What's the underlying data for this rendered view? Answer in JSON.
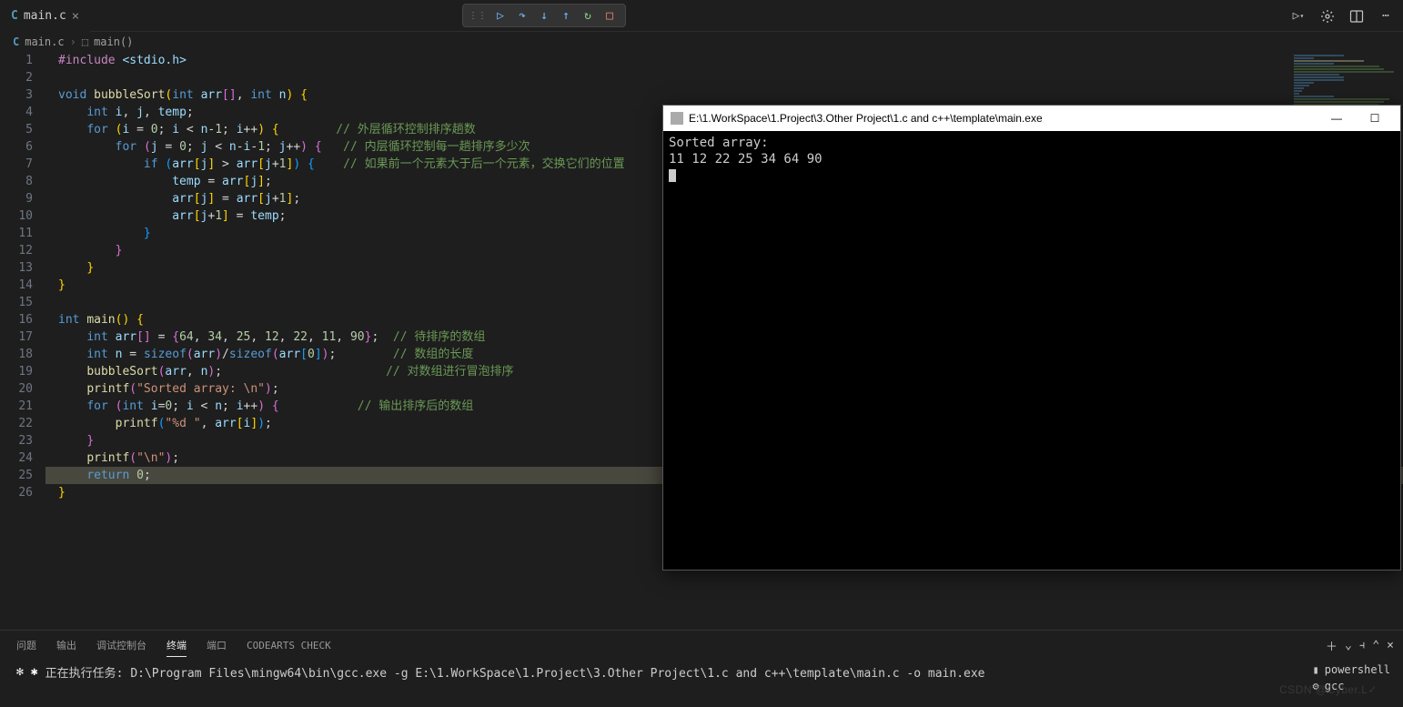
{
  "tab": {
    "icon": "C",
    "name": "main.c"
  },
  "breadcrumb": {
    "file": "main.c",
    "symbol": "main()"
  },
  "lines": [
    {
      "n": 1,
      "seg": [
        [
          "mac",
          "#include "
        ],
        [
          "inc",
          "<stdio.h>"
        ]
      ]
    },
    {
      "n": 2,
      "seg": []
    },
    {
      "n": 3,
      "seg": [
        [
          "kw",
          "void"
        ],
        [
          "op",
          " "
        ],
        [
          "fn",
          "bubbleSort"
        ],
        [
          "pn",
          "("
        ],
        [
          "kw",
          "int"
        ],
        [
          "op",
          " "
        ],
        [
          "var",
          "arr"
        ],
        [
          "pn2",
          "[]"
        ],
        [
          "op",
          ", "
        ],
        [
          "kw",
          "int"
        ],
        [
          "op",
          " "
        ],
        [
          "var",
          "n"
        ],
        [
          "pn",
          ")"
        ],
        [
          "op",
          " "
        ],
        [
          "pn",
          "{"
        ]
      ]
    },
    {
      "n": 4,
      "indent": 1,
      "seg": [
        [
          "kw",
          "int"
        ],
        [
          "op",
          " "
        ],
        [
          "var",
          "i"
        ],
        [
          "op",
          ", "
        ],
        [
          "var",
          "j"
        ],
        [
          "op",
          ", "
        ],
        [
          "var",
          "temp"
        ],
        [
          "op",
          ";"
        ]
      ]
    },
    {
      "n": 5,
      "indent": 1,
      "seg": [
        [
          "kw",
          "for"
        ],
        [
          "op",
          " "
        ],
        [
          "pn",
          "("
        ],
        [
          "var",
          "i"
        ],
        [
          "op",
          " = "
        ],
        [
          "num",
          "0"
        ],
        [
          "op",
          "; "
        ],
        [
          "var",
          "i"
        ],
        [
          "op",
          " < "
        ],
        [
          "var",
          "n"
        ],
        [
          "op",
          "-"
        ],
        [
          "num",
          "1"
        ],
        [
          "op",
          "; "
        ],
        [
          "var",
          "i"
        ],
        [
          "op",
          "++"
        ],
        [
          "pn",
          ")"
        ],
        [
          "op",
          " "
        ],
        [
          "pn",
          "{"
        ],
        [
          "op",
          "        "
        ],
        [
          "cmt",
          "// 外层循环控制排序趟数"
        ]
      ]
    },
    {
      "n": 6,
      "indent": 2,
      "seg": [
        [
          "kw",
          "for"
        ],
        [
          "op",
          " "
        ],
        [
          "pn2",
          "("
        ],
        [
          "var",
          "j"
        ],
        [
          "op",
          " = "
        ],
        [
          "num",
          "0"
        ],
        [
          "op",
          "; "
        ],
        [
          "var",
          "j"
        ],
        [
          "op",
          " < "
        ],
        [
          "var",
          "n"
        ],
        [
          "op",
          "-"
        ],
        [
          "var",
          "i"
        ],
        [
          "op",
          "-"
        ],
        [
          "num",
          "1"
        ],
        [
          "op",
          "; "
        ],
        [
          "var",
          "j"
        ],
        [
          "op",
          "++"
        ],
        [
          "pn2",
          ")"
        ],
        [
          "op",
          " "
        ],
        [
          "pn2",
          "{"
        ],
        [
          "op",
          "   "
        ],
        [
          "cmt",
          "// 内层循环控制每一趟排序多少次"
        ]
      ]
    },
    {
      "n": 7,
      "indent": 3,
      "seg": [
        [
          "kw",
          "if"
        ],
        [
          "op",
          " "
        ],
        [
          "pn3",
          "("
        ],
        [
          "var",
          "arr"
        ],
        [
          "pn",
          "["
        ],
        [
          "var",
          "j"
        ],
        [
          "pn",
          "]"
        ],
        [
          "op",
          " > "
        ],
        [
          "var",
          "arr"
        ],
        [
          "pn",
          "["
        ],
        [
          "var",
          "j"
        ],
        [
          "op",
          "+"
        ],
        [
          "num",
          "1"
        ],
        [
          "pn",
          "]"
        ],
        [
          "pn3",
          ")"
        ],
        [
          "op",
          " "
        ],
        [
          "pn3",
          "{"
        ],
        [
          "op",
          "    "
        ],
        [
          "cmt",
          "// 如果前一个元素大于后一个元素，交换它们的位置"
        ]
      ]
    },
    {
      "n": 8,
      "indent": 4,
      "seg": [
        [
          "var",
          "temp"
        ],
        [
          "op",
          " = "
        ],
        [
          "var",
          "arr"
        ],
        [
          "pn",
          "["
        ],
        [
          "var",
          "j"
        ],
        [
          "pn",
          "]"
        ],
        [
          "op",
          ";"
        ]
      ]
    },
    {
      "n": 9,
      "indent": 4,
      "seg": [
        [
          "var",
          "arr"
        ],
        [
          "pn",
          "["
        ],
        [
          "var",
          "j"
        ],
        [
          "pn",
          "]"
        ],
        [
          "op",
          " = "
        ],
        [
          "var",
          "arr"
        ],
        [
          "pn",
          "["
        ],
        [
          "var",
          "j"
        ],
        [
          "op",
          "+"
        ],
        [
          "num",
          "1"
        ],
        [
          "pn",
          "]"
        ],
        [
          "op",
          ";"
        ]
      ]
    },
    {
      "n": 10,
      "indent": 4,
      "seg": [
        [
          "var",
          "arr"
        ],
        [
          "pn",
          "["
        ],
        [
          "var",
          "j"
        ],
        [
          "op",
          "+"
        ],
        [
          "num",
          "1"
        ],
        [
          "pn",
          "]"
        ],
        [
          "op",
          " = "
        ],
        [
          "var",
          "temp"
        ],
        [
          "op",
          ";"
        ]
      ]
    },
    {
      "n": 11,
      "indent": 3,
      "seg": [
        [
          "pn3",
          "}"
        ]
      ]
    },
    {
      "n": 12,
      "indent": 2,
      "seg": [
        [
          "pn2",
          "}"
        ]
      ]
    },
    {
      "n": 13,
      "indent": 1,
      "seg": [
        [
          "pn",
          "}"
        ]
      ]
    },
    {
      "n": 14,
      "seg": [
        [
          "pn",
          "}"
        ]
      ]
    },
    {
      "n": 15,
      "seg": []
    },
    {
      "n": 16,
      "seg": [
        [
          "kw",
          "int"
        ],
        [
          "op",
          " "
        ],
        [
          "fn",
          "main"
        ],
        [
          "pn",
          "()"
        ],
        [
          "op",
          " "
        ],
        [
          "pn",
          "{"
        ]
      ]
    },
    {
      "n": 17,
      "indent": 1,
      "seg": [
        [
          "kw",
          "int"
        ],
        [
          "op",
          " "
        ],
        [
          "var",
          "arr"
        ],
        [
          "pn2",
          "[]"
        ],
        [
          "op",
          " = "
        ],
        [
          "pn2",
          "{"
        ],
        [
          "num",
          "64"
        ],
        [
          "op",
          ", "
        ],
        [
          "num",
          "34"
        ],
        [
          "op",
          ", "
        ],
        [
          "num",
          "25"
        ],
        [
          "op",
          ", "
        ],
        [
          "num",
          "12"
        ],
        [
          "op",
          ", "
        ],
        [
          "num",
          "22"
        ],
        [
          "op",
          ", "
        ],
        [
          "num",
          "11"
        ],
        [
          "op",
          ", "
        ],
        [
          "num",
          "90"
        ],
        [
          "pn2",
          "}"
        ],
        [
          "op",
          ";  "
        ],
        [
          "cmt",
          "// 待排序的数组"
        ]
      ]
    },
    {
      "n": 18,
      "indent": 1,
      "seg": [
        [
          "kw",
          "int"
        ],
        [
          "op",
          " "
        ],
        [
          "var",
          "n"
        ],
        [
          "op",
          " = "
        ],
        [
          "kw",
          "sizeof"
        ],
        [
          "pn2",
          "("
        ],
        [
          "var",
          "arr"
        ],
        [
          "pn2",
          ")"
        ],
        [
          "op",
          "/"
        ],
        [
          "kw",
          "sizeof"
        ],
        [
          "pn2",
          "("
        ],
        [
          "var",
          "arr"
        ],
        [
          "pn3",
          "["
        ],
        [
          "num",
          "0"
        ],
        [
          "pn3",
          "]"
        ],
        [
          "pn2",
          ")"
        ],
        [
          "op",
          ";        "
        ],
        [
          "cmt",
          "// 数组的长度"
        ]
      ]
    },
    {
      "n": 19,
      "indent": 1,
      "seg": [
        [
          "fn",
          "bubbleSort"
        ],
        [
          "pn2",
          "("
        ],
        [
          "var",
          "arr"
        ],
        [
          "op",
          ", "
        ],
        [
          "var",
          "n"
        ],
        [
          "pn2",
          ")"
        ],
        [
          "op",
          ";                       "
        ],
        [
          "cmt",
          "// 对数组进行冒泡排序"
        ]
      ]
    },
    {
      "n": 20,
      "indent": 1,
      "seg": [
        [
          "fn",
          "printf"
        ],
        [
          "pn2",
          "("
        ],
        [
          "str",
          "\"Sorted array: \\n\""
        ],
        [
          "pn2",
          ")"
        ],
        [
          "op",
          ";"
        ]
      ]
    },
    {
      "n": 21,
      "indent": 1,
      "seg": [
        [
          "kw",
          "for"
        ],
        [
          "op",
          " "
        ],
        [
          "pn2",
          "("
        ],
        [
          "kw",
          "int"
        ],
        [
          "op",
          " "
        ],
        [
          "var",
          "i"
        ],
        [
          "op",
          "="
        ],
        [
          "num",
          "0"
        ],
        [
          "op",
          "; "
        ],
        [
          "var",
          "i"
        ],
        [
          "op",
          " < "
        ],
        [
          "var",
          "n"
        ],
        [
          "op",
          "; "
        ],
        [
          "var",
          "i"
        ],
        [
          "op",
          "++"
        ],
        [
          "pn2",
          ")"
        ],
        [
          "op",
          " "
        ],
        [
          "pn2",
          "{"
        ],
        [
          "op",
          "           "
        ],
        [
          "cmt",
          "// 输出排序后的数组"
        ]
      ]
    },
    {
      "n": 22,
      "indent": 2,
      "seg": [
        [
          "fn",
          "printf"
        ],
        [
          "pn3",
          "("
        ],
        [
          "str",
          "\"%d \""
        ],
        [
          "op",
          ", "
        ],
        [
          "var",
          "arr"
        ],
        [
          "pn",
          "["
        ],
        [
          "var",
          "i"
        ],
        [
          "pn",
          "]"
        ],
        [
          "pn3",
          ")"
        ],
        [
          "op",
          ";"
        ]
      ]
    },
    {
      "n": 23,
      "indent": 1,
      "seg": [
        [
          "pn2",
          "}"
        ]
      ]
    },
    {
      "n": 24,
      "indent": 1,
      "seg": [
        [
          "fn",
          "printf"
        ],
        [
          "pn2",
          "("
        ],
        [
          "str",
          "\"\\n\""
        ],
        [
          "pn2",
          ")"
        ],
        [
          "op",
          ";"
        ]
      ]
    },
    {
      "n": 25,
      "indent": 1,
      "hl": true,
      "bp": "hollow",
      "seg": [
        [
          "kw",
          "return"
        ],
        [
          "op",
          " "
        ],
        [
          "num",
          "0"
        ],
        [
          "op",
          ";"
        ]
      ]
    },
    {
      "n": 26,
      "seg": [
        [
          "pn",
          "}"
        ]
      ]
    }
  ],
  "panel": {
    "tabs": [
      "问题",
      "输出",
      "调试控制台",
      "终端",
      "端口",
      "CODEARTS CHECK"
    ],
    "active": 3,
    "task_prefix": "正在执行任务: ",
    "task_cmd": "D:\\Program Files\\mingw64\\bin\\gcc.exe -g E:\\1.WorkSpace\\1.Project\\3.Other Project\\1.c and c++\\template\\main.c -o main.exe",
    "terminals": [
      "powershell",
      "gcc"
    ]
  },
  "console": {
    "title": "E:\\1.WorkSpace\\1.Project\\3.Other Project\\1.c and c++\\template\\main.exe",
    "output": "Sorted array:\n11 12 22 25 34 64 90"
  },
  "watermark": "CSDN @Cyber.L✓"
}
